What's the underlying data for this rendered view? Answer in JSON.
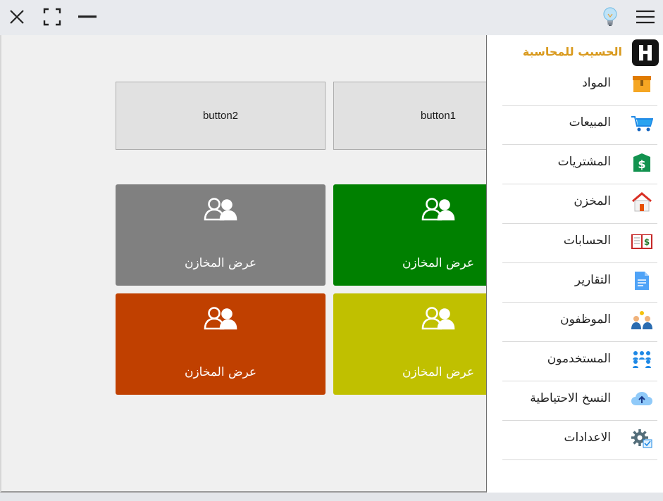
{
  "window": {
    "icons": [
      "close-icon",
      "maximize-icon",
      "minimize-icon",
      "lightbulb-icon",
      "hamburger-menu-icon"
    ]
  },
  "buttons": {
    "button1": "button1",
    "button2": "button2"
  },
  "tiles": [
    {
      "label": "عرض المخازن",
      "color": "#008000",
      "icon": "users-icon"
    },
    {
      "label": "عرض المخازن",
      "color": "#808080",
      "icon": "users-icon"
    },
    {
      "label": "عرض المخازن",
      "color": "#c0c000",
      "icon": "users-icon"
    },
    {
      "label": "عرض المخازن",
      "color": "#c04000",
      "icon": "users-icon"
    }
  ],
  "sidebar": {
    "brand": "الحسيب للمحاسبة",
    "brand_color": "#d99a1e",
    "items": [
      {
        "label": "المواد",
        "icon": "box-icon"
      },
      {
        "label": "المبيعات",
        "icon": "shopping-cart-icon"
      },
      {
        "label": "المشتريات",
        "icon": "dollar-tag-icon"
      },
      {
        "label": "المخزن",
        "icon": "house-icon"
      },
      {
        "label": "الحسابات",
        "icon": "ledger-book-icon"
      },
      {
        "label": "التقارير",
        "icon": "document-icon"
      },
      {
        "label": "الموظفون",
        "icon": "employees-icon"
      },
      {
        "label": "المستخدمون",
        "icon": "users-group-icon"
      },
      {
        "label": "النسخ الاحتياطية",
        "icon": "cloud-upload-icon"
      },
      {
        "label": "الاعدادات",
        "icon": "settings-gear-icon"
      }
    ]
  }
}
